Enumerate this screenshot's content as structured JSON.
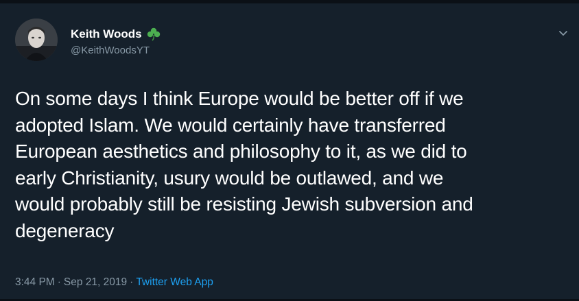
{
  "tweet": {
    "author": {
      "display_name": "Keith Woods",
      "handle": "@KeithWoodsYT",
      "badge_icon": "shamrock-icon"
    },
    "text_lines": [
      "On some days I think Europe would be better off if we",
      "adopted Islam. We would certainly have transferred",
      "European aesthetics and philosophy to it, as we did to",
      "early Christianity, usury would be outlawed, and we",
      "would probably still be resisting Jewish subversion and",
      "degeneracy"
    ],
    "time": "3:44 PM",
    "separator": "·",
    "date": "Sep 21, 2019",
    "source": "Twitter Web App",
    "menu_icon": "chevron-down-icon"
  },
  "colors": {
    "background": "#15202b",
    "text_primary": "#ffffff",
    "text_secondary": "#8899a6",
    "link": "#1da1f2",
    "shamrock": "#4caf50"
  }
}
